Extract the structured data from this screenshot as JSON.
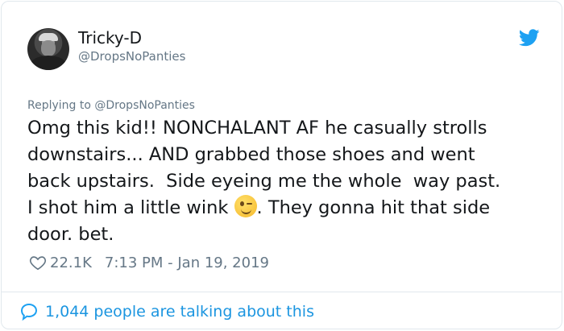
{
  "user": {
    "name": "Tricky-D",
    "handle": "@DropsNoPanties"
  },
  "reply": {
    "prefix": "Replying to ",
    "handle": "@DropsNoPanties"
  },
  "tweet": {
    "text_before_emoji": "Omg this kid!! NONCHALANT AF he casually strolls\ndownstairs... AND grabbed those shoes and went\nback upstairs.  Side eyeing me the whole  way past.\nI shot him a little wink ",
    "emoji": "winking-face",
    "text_after_emoji": ". They gonna hit that side\ndoor. bet."
  },
  "meta": {
    "likes": "22.1K",
    "timestamp": "7:13 PM - Jan 19, 2019"
  },
  "footer": {
    "conversation_text": "1,044 people are talking about this"
  },
  "colors": {
    "twitter_blue": "#1da1f2",
    "secondary_text": "#657786",
    "border": "#e1e8ed"
  }
}
